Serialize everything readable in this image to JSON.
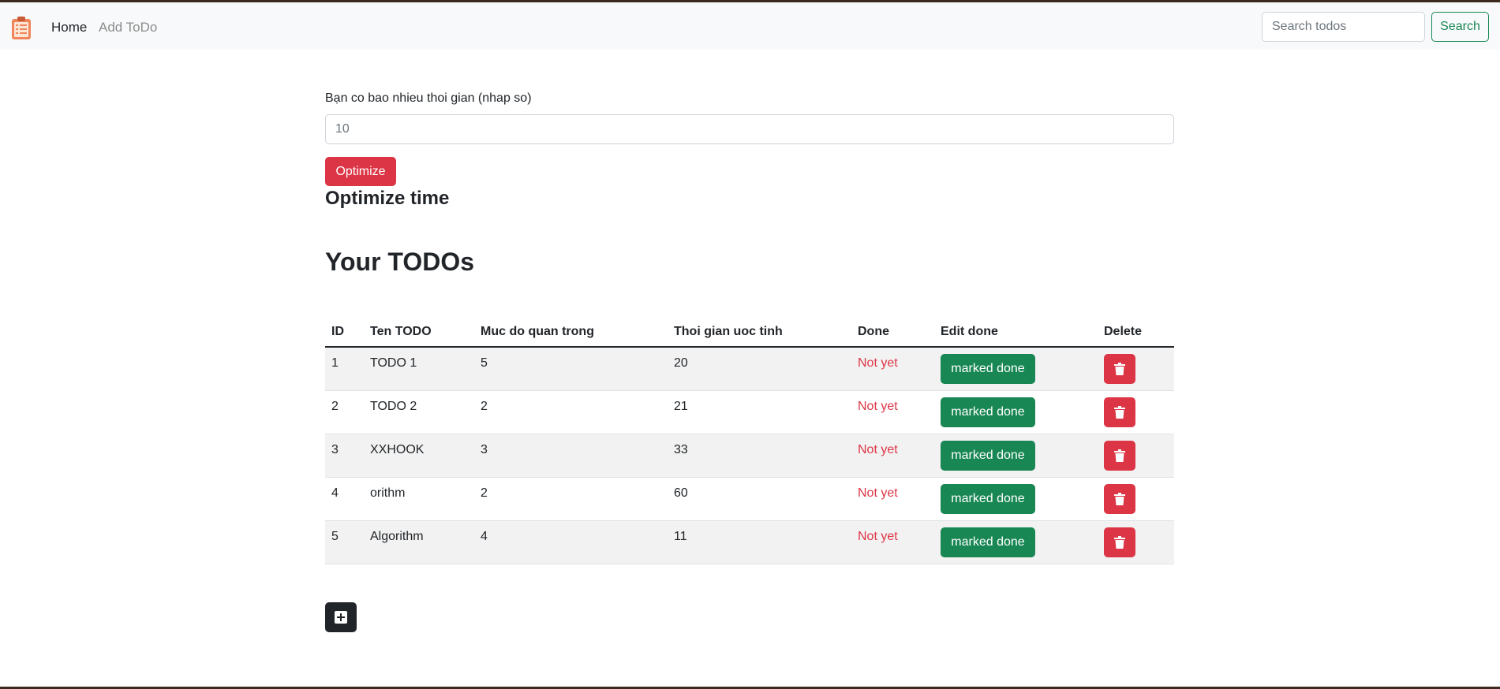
{
  "navbar": {
    "logo_icon": "clipboard-icon",
    "links": [
      {
        "label": "Home",
        "active": true
      },
      {
        "label": "Add ToDo",
        "active": false
      }
    ],
    "search": {
      "placeholder": "Search todos",
      "button_label": "Search"
    }
  },
  "form": {
    "label": "Bạn co bao nhieu thoi gian (nhap so)",
    "placeholder": "10",
    "button_label": "Optimize",
    "result_heading": "Optimize time"
  },
  "todos": {
    "heading": "Your TODOs",
    "columns": [
      "ID",
      "Ten TODO",
      "Muc do quan trong",
      "Thoi gian uoc tinh",
      "Done",
      "Edit done",
      "Delete"
    ],
    "rows": [
      {
        "id": "1",
        "name": "TODO 1",
        "importance": "5",
        "time": "20",
        "status": "Not yet",
        "action": "marked done"
      },
      {
        "id": "2",
        "name": "TODO 2",
        "importance": "2",
        "time": "21",
        "status": "Not yet",
        "action": "marked done"
      },
      {
        "id": "3",
        "name": "XXHOOK",
        "importance": "3",
        "time": "33",
        "status": "Not yet",
        "action": "marked done"
      },
      {
        "id": "4",
        "name": "orithm",
        "importance": "2",
        "time": "60",
        "status": "Not yet",
        "action": "marked done"
      },
      {
        "id": "5",
        "name": "Algorithm",
        "importance": "4",
        "time": "11",
        "status": "Not yet",
        "action": "marked done"
      }
    ]
  },
  "colors": {
    "success": "#198754",
    "danger": "#dc3545",
    "dark": "#212529",
    "navbar_bg": "#f8f9fa"
  },
  "icons": {
    "delete": "trash-icon",
    "add": "plus-square-icon"
  }
}
